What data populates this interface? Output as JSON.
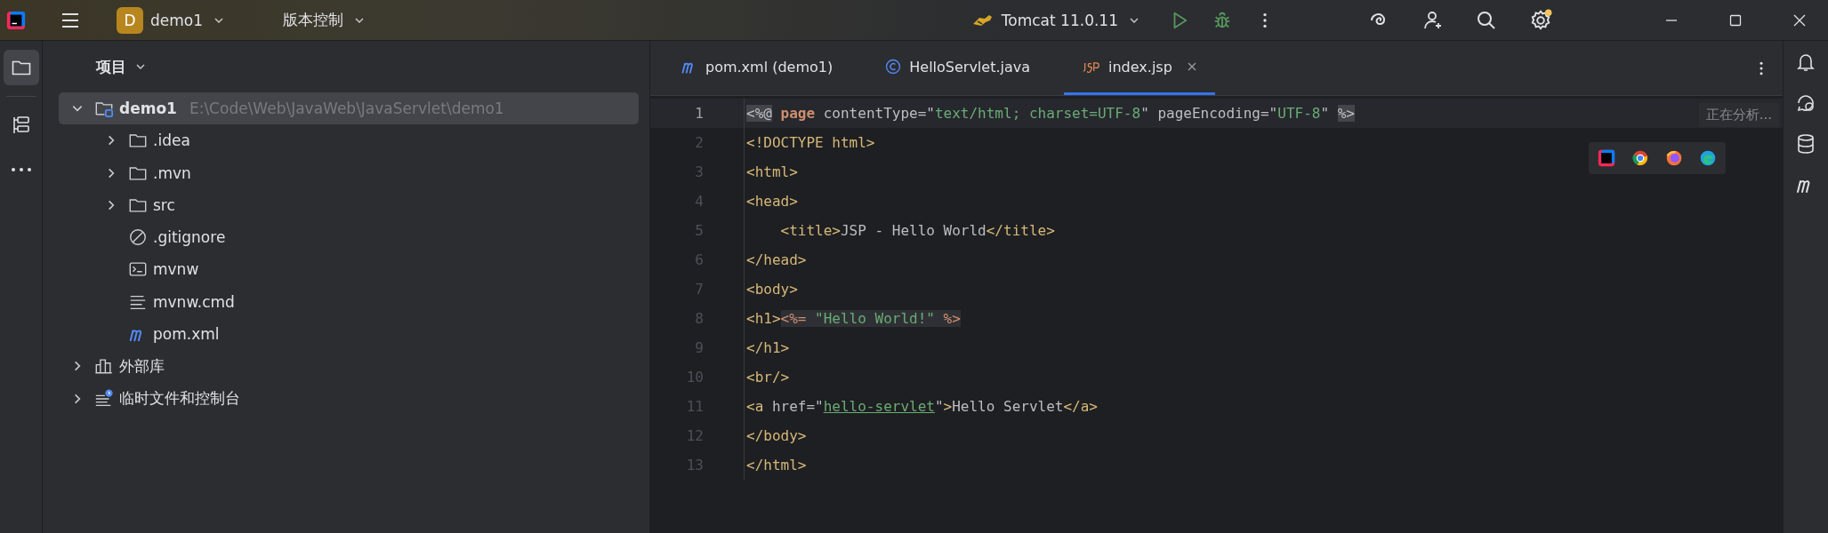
{
  "title_bar": {
    "project": {
      "badge": "D",
      "name": "demo1"
    },
    "vcs": "版本控制",
    "run_config": "Tomcat 11.0.11",
    "settings_notification": true
  },
  "project_panel": {
    "title": "项目",
    "tree": [
      {
        "name": "demo1",
        "path": "E:\\Code\\Web\\JavaWeb\\JavaServlet\\demo1",
        "kind": "module",
        "expanded": true,
        "selected": true,
        "children": [
          {
            "name": ".idea",
            "kind": "folder",
            "expanded": false,
            "selected": false
          },
          {
            "name": ".mvn",
            "kind": "folder",
            "expanded": false,
            "selected": false
          },
          {
            "name": "src",
            "kind": "folder",
            "expanded": false,
            "selected": false
          },
          {
            "name": ".gitignore",
            "kind": "ignore",
            "selected": false
          },
          {
            "name": "mvnw",
            "kind": "shell",
            "selected": false
          },
          {
            "name": "mvnw.cmd",
            "kind": "text",
            "selected": false
          },
          {
            "name": "pom.xml",
            "kind": "maven",
            "selected": false
          }
        ]
      },
      {
        "name": "外部库",
        "kind": "libraries",
        "expanded": false,
        "selected": false
      },
      {
        "name": "临时文件和控制台",
        "kind": "scratches",
        "expanded": false,
        "selected": false
      }
    ]
  },
  "editor": {
    "tabs": [
      {
        "label": "pom.xml (demo1)",
        "kind": "maven",
        "selected": false
      },
      {
        "label": "HelloServlet.java",
        "kind": "class",
        "selected": false
      },
      {
        "label": "index.jsp",
        "kind": "jsp",
        "selected": true
      }
    ],
    "status": "正在分析...",
    "lines": [
      {
        "number": "1",
        "current": true,
        "tokens": [
          {
            "text": "<%@",
            "kind": "delim"
          },
          {
            "text": " page",
            "kind": "keyword"
          },
          {
            "text": " contentType=\"",
            "kind": "plain"
          },
          {
            "text": "text/html; charset=UTF-8",
            "kind": "string"
          },
          {
            "text": "\" pageEncoding=\"",
            "kind": "plain"
          },
          {
            "text": "UTF-8",
            "kind": "string"
          },
          {
            "text": "\" ",
            "kind": "plain"
          },
          {
            "text": "%>",
            "kind": "delim"
          }
        ]
      },
      {
        "number": "2",
        "current": false,
        "tokens": [
          {
            "text": "<!DOCTYPE html>",
            "kind": "tag"
          }
        ]
      },
      {
        "number": "3",
        "current": false,
        "tokens": [
          {
            "text": "<html>",
            "kind": "tag"
          }
        ]
      },
      {
        "number": "4",
        "current": false,
        "tokens": [
          {
            "text": "<head>",
            "kind": "tag"
          }
        ]
      },
      {
        "number": "5",
        "current": false,
        "tokens": [
          {
            "text": "    <title>",
            "kind": "tag"
          },
          {
            "text": "JSP - Hello World",
            "kind": "plain"
          },
          {
            "text": "</title>",
            "kind": "tag"
          }
        ]
      },
      {
        "number": "6",
        "current": false,
        "tokens": [
          {
            "text": "</head>",
            "kind": "tag"
          }
        ]
      },
      {
        "number": "7",
        "current": false,
        "tokens": [
          {
            "text": "<body>",
            "kind": "tag"
          }
        ]
      },
      {
        "number": "8",
        "current": false,
        "tokens": [
          {
            "text": "<h1>",
            "kind": "tag"
          },
          {
            "text": "<%=",
            "kind": "expr_delim"
          },
          {
            "text": " \"Hello World!\" ",
            "kind": "expr_string"
          },
          {
            "text": "%>",
            "kind": "expr_delim"
          }
        ]
      },
      {
        "number": "9",
        "current": false,
        "tokens": [
          {
            "text": "</h1>",
            "kind": "tag"
          }
        ]
      },
      {
        "number": "10",
        "current": false,
        "tokens": [
          {
            "text": "<br/>",
            "kind": "tag"
          }
        ]
      },
      {
        "number": "11",
        "current": false,
        "tokens": [
          {
            "text": "<a ",
            "kind": "tag"
          },
          {
            "text": "href=\"",
            "kind": "plain"
          },
          {
            "text": "hello-servlet",
            "kind": "link"
          },
          {
            "text": "\"",
            "kind": "plain"
          },
          {
            "text": ">",
            "kind": "tag"
          },
          {
            "text": "Hello Servlet",
            "kind": "plain"
          },
          {
            "text": "</a>",
            "kind": "tag"
          }
        ]
      },
      {
        "number": "12",
        "current": false,
        "tokens": [
          {
            "text": "</body>",
            "kind": "tag"
          }
        ]
      },
      {
        "number": "13",
        "current": false,
        "tokens": [
          {
            "text": "</html>",
            "kind": "tag"
          }
        ]
      }
    ]
  }
}
